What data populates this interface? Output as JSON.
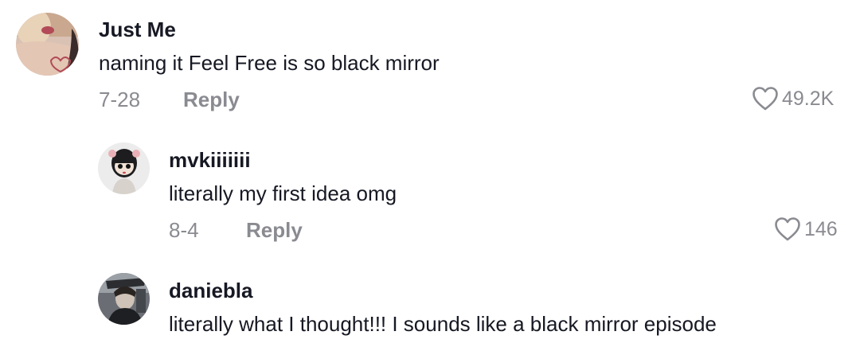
{
  "comments": [
    {
      "username": "Just Me",
      "text": "naming it Feel Free is so black mirror",
      "date": "7-28",
      "reply_label": "Reply",
      "likes": "49.2K",
      "avatar_icon": "user-avatar"
    },
    {
      "username": "mvkiiiiiii",
      "text": "literally my first idea omg",
      "date": "8-4",
      "reply_label": "Reply",
      "likes": "146",
      "avatar_icon": "user-avatar"
    },
    {
      "username": "daniebla",
      "text": "literally what I thought!!! I sounds like a black mirror episode",
      "avatar_icon": "user-avatar"
    }
  ],
  "colors": {
    "primary_text": "#161823",
    "secondary_text": "#8a8b91",
    "background": "#ffffff"
  }
}
